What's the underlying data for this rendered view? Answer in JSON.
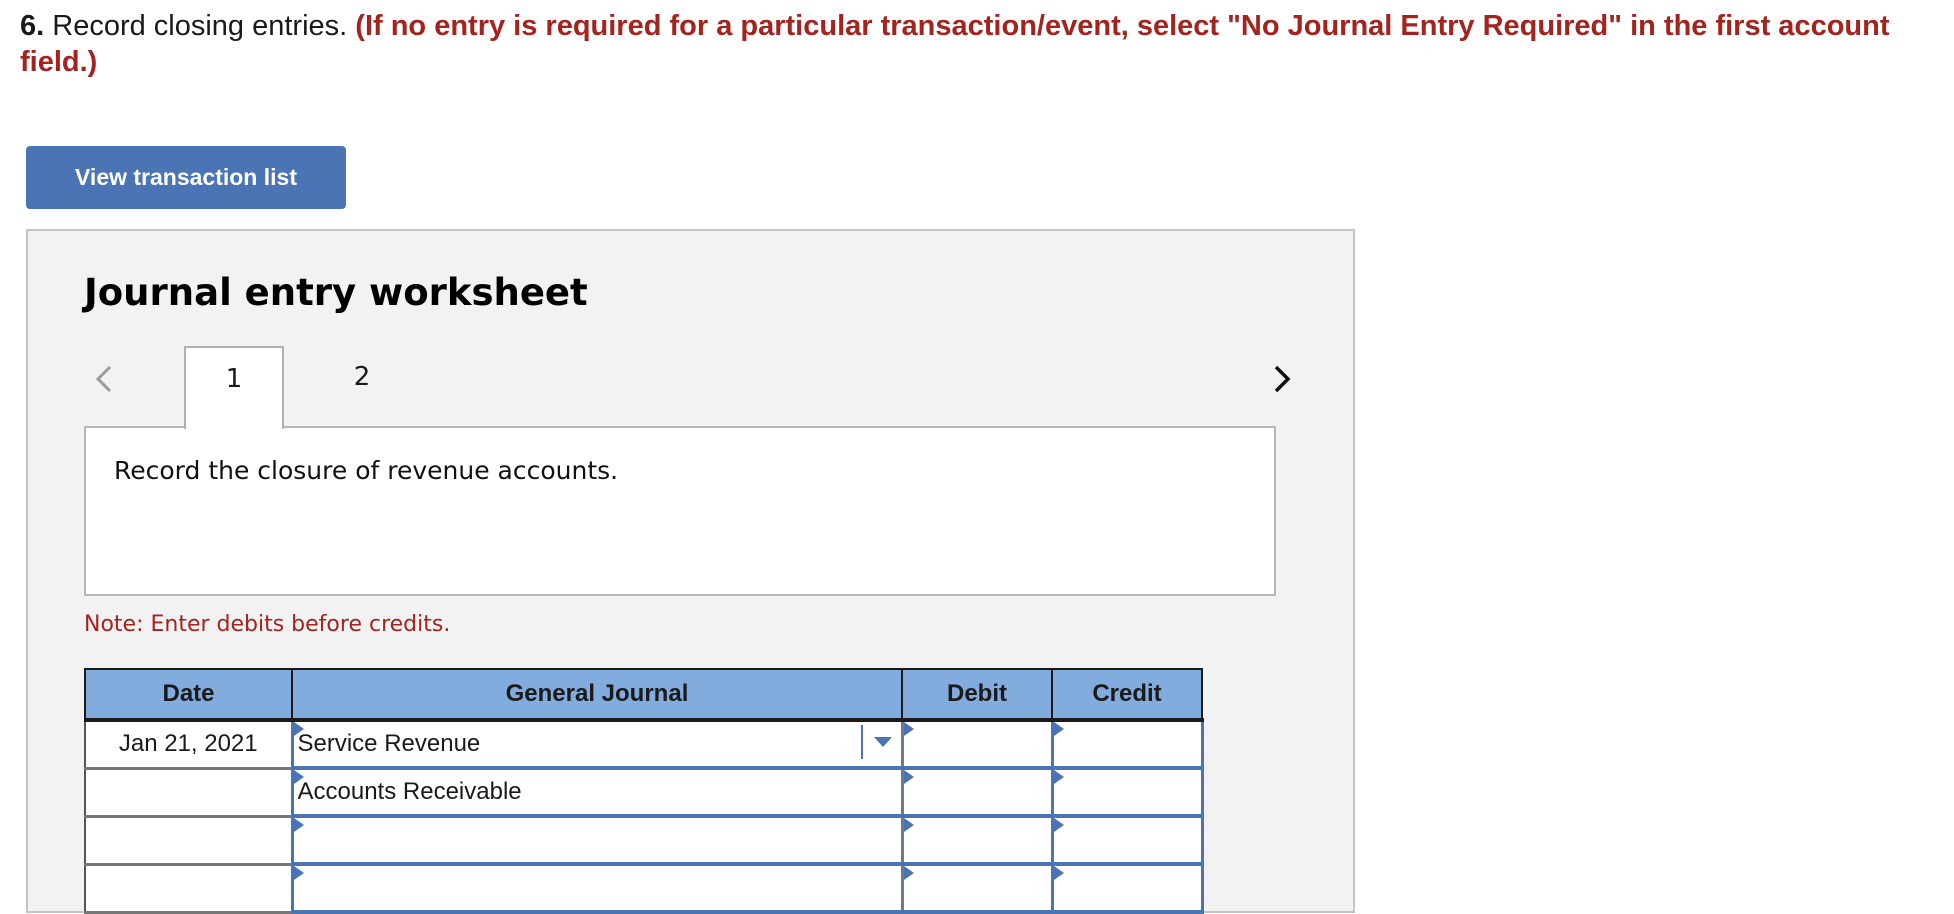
{
  "question": {
    "number": "6.",
    "text": " Record closing entries. ",
    "instruction": "(If no entry is required for a particular transaction/event, select \"No Journal Entry Required\" in the first account field.)"
  },
  "buttons": {
    "view_transactions": "View transaction list"
  },
  "worksheet": {
    "title": "Journal entry worksheet",
    "tabs": [
      {
        "label": "1",
        "active": true
      },
      {
        "label": "2",
        "active": false
      }
    ],
    "description": "Record the closure of revenue accounts.",
    "note": "Note: Enter debits before credits.",
    "table": {
      "headers": {
        "date": "Date",
        "general_journal": "General Journal",
        "debit": "Debit",
        "credit": "Credit"
      },
      "rows": [
        {
          "date": "Jan 21, 2021",
          "account": "Service Revenue",
          "debit": "",
          "credit": ""
        },
        {
          "date": "",
          "account": "Accounts Receivable",
          "debit": "",
          "credit": ""
        },
        {
          "date": "",
          "account": "",
          "debit": "",
          "credit": ""
        },
        {
          "date": "",
          "account": "",
          "debit": "",
          "credit": ""
        }
      ]
    }
  },
  "icons": {
    "prev": "chevron-left-icon",
    "next": "chevron-right-icon",
    "dropdown": "caret-down-icon"
  },
  "colors": {
    "accent": "#4a74b3",
    "header": "#82abde",
    "instruction": "#a3231e",
    "panel": "#f2f2f2"
  }
}
